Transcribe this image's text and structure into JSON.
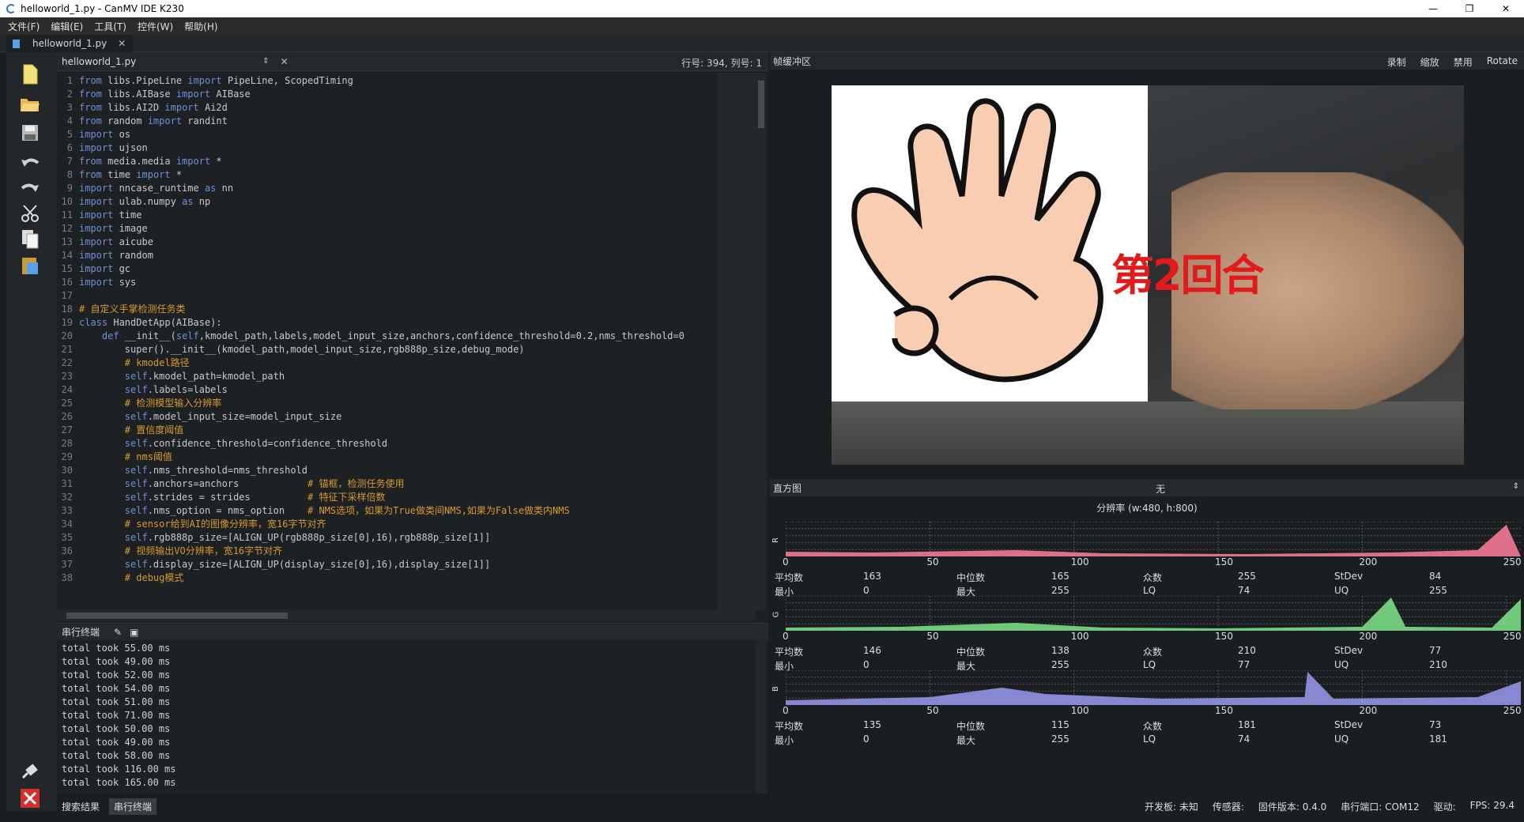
{
  "window": {
    "title": "helloworld_1.py - CanMV IDE K230",
    "min": "—",
    "max": "❐",
    "close": "✕"
  },
  "menu": [
    "文件(F)",
    "编辑(E)",
    "工具(T)",
    "控件(W)",
    "帮助(H)"
  ],
  "tab": {
    "label": "helloworld_1.py",
    "close": "✕"
  },
  "editor": {
    "file": "helloworld_1.py",
    "arrows": "⇕",
    "close": "✕",
    "position": "行号: 394, 列号: 1"
  },
  "code": [
    {
      "n": "1",
      "t": "from libs.PipeLine import PipeLine, ScopedTiming"
    },
    {
      "n": "2",
      "t": "from libs.AIBase import AIBase"
    },
    {
      "n": "3",
      "t": "from libs.AI2D import Ai2d"
    },
    {
      "n": "4",
      "t": "from random import randint"
    },
    {
      "n": "5",
      "t": "import os"
    },
    {
      "n": "6",
      "t": "import ujson"
    },
    {
      "n": "7",
      "t": "from media.media import *"
    },
    {
      "n": "8",
      "t": "from time import *"
    },
    {
      "n": "9",
      "t": "import nncase_runtime as nn"
    },
    {
      "n": "10",
      "t": "import ulab.numpy as np"
    },
    {
      "n": "11",
      "t": "import time"
    },
    {
      "n": "12",
      "t": "import image"
    },
    {
      "n": "13",
      "t": "import aicube"
    },
    {
      "n": "14",
      "t": "import random"
    },
    {
      "n": "15",
      "t": "import gc"
    },
    {
      "n": "16",
      "t": "import sys"
    },
    {
      "n": "17",
      "t": ""
    },
    {
      "n": "18",
      "t": "# 自定义手掌检测任务类"
    },
    {
      "n": "19",
      "t": "class HandDetApp(AIBase):"
    },
    {
      "n": "20",
      "t": "    def __init__(self,kmodel_path,labels,model_input_size,anchors,confidence_threshold=0.2,nms_threshold=0"
    },
    {
      "n": "21",
      "t": "        super().__init__(kmodel_path,model_input_size,rgb888p_size,debug_mode)"
    },
    {
      "n": "22",
      "t": "        # kmodel路径"
    },
    {
      "n": "23",
      "t": "        self.kmodel_path=kmodel_path"
    },
    {
      "n": "24",
      "t": "        self.labels=labels"
    },
    {
      "n": "25",
      "t": "        # 检测模型输入分辨率"
    },
    {
      "n": "26",
      "t": "        self.model_input_size=model_input_size"
    },
    {
      "n": "27",
      "t": "        # 置信度阈值"
    },
    {
      "n": "28",
      "t": "        self.confidence_threshold=confidence_threshold"
    },
    {
      "n": "29",
      "t": "        # nms阈值"
    },
    {
      "n": "30",
      "t": "        self.nms_threshold=nms_threshold"
    },
    {
      "n": "31",
      "t": "        self.anchors=anchors            # 锚框，检测任务使用"
    },
    {
      "n": "32",
      "t": "        self.strides = strides          # 特征下采样倍数"
    },
    {
      "n": "33",
      "t": "        self.nms_option = nms_option    # NMS选项，如果为True做类间NMS,如果为False做类内NMS"
    },
    {
      "n": "34",
      "t": "        # sensor给到AI的图像分辨率，宽16字节对齐"
    },
    {
      "n": "35",
      "t": "        self.rgb888p_size=[ALIGN_UP(rgb888p_size[0],16),rgb888p_size[1]]"
    },
    {
      "n": "36",
      "t": "        # 视频输出VO分辨率，宽16字节对齐"
    },
    {
      "n": "37",
      "t": "        self.display_size=[ALIGN_UP(display_size[0],16),display_size[1]]"
    },
    {
      "n": "38",
      "t": "        # debug模式"
    }
  ],
  "serial": {
    "title": "串行终端",
    "lines": [
      "total took 55.00 ms",
      "total took 49.00 ms",
      "total took 52.00 ms",
      "total took 54.00 ms",
      "total took 51.00 ms",
      "total took 71.00 ms",
      "total took 50.00 ms",
      "total took 49.00 ms",
      "total took 58.00 ms",
      "total took 116.00 ms",
      "total took 165.00 ms"
    ]
  },
  "bottomtabs": [
    "搜索结果",
    "串行终端"
  ],
  "frame": {
    "title": "帧缓冲区",
    "buttons": [
      "录制",
      "缩放",
      "禁用",
      "Rotate"
    ],
    "overlay": "第2回合"
  },
  "hist": {
    "title": "直方图",
    "selection": "无",
    "resolution": "分辨率 (w:480, h:800)",
    "ticks": [
      "0",
      "50",
      "100",
      "150",
      "200",
      "250"
    ],
    "labels": {
      "mean": "平均数",
      "median": "中位数",
      "mode": "众数",
      "stdev": "StDev",
      "min": "最小",
      "max": "最大",
      "lq": "LQ",
      "uq": "UQ"
    },
    "channels": [
      {
        "name": "R",
        "color": "#ff7f9a",
        "mean": "163",
        "median": "165",
        "mode": "255",
        "stdev": "84",
        "min": "0",
        "max": "255",
        "lq": "74",
        "uq": "255"
      },
      {
        "name": "G",
        "color": "#7fe68a",
        "mean": "146",
        "median": "138",
        "mode": "210",
        "stdev": "77",
        "min": "0",
        "max": "255",
        "lq": "77",
        "uq": "210"
      },
      {
        "name": "B",
        "color": "#9a9af0",
        "mean": "135",
        "median": "115",
        "mode": "181",
        "stdev": "73",
        "min": "0",
        "max": "255",
        "lq": "74",
        "uq": "181"
      }
    ]
  },
  "status": {
    "board": "开发板: 未知",
    "sensor": "传感器:",
    "firmware": "固件版本: 0.4.0",
    "port": "串行端口: COM12",
    "driver": "驱动:",
    "fps": "FPS:  29.4"
  }
}
